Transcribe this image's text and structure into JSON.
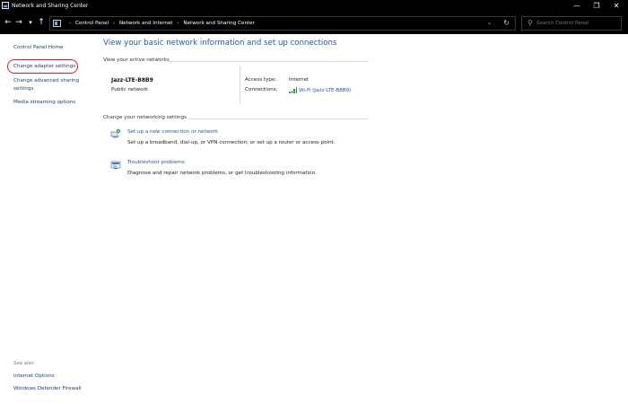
{
  "window": {
    "title": "Network and Sharing Center",
    "minimize_glyph": "—",
    "maximize_glyph": "❐",
    "close_glyph": "✕"
  },
  "nav": {
    "back_glyph": "←",
    "forward_glyph": "→",
    "recent_glyph": "▾",
    "up_glyph": "↑"
  },
  "address": {
    "breadcrumbs": [
      "Control Panel",
      "Network and Internet",
      "Network and Sharing Center"
    ],
    "separator": "›",
    "dropdown_glyph": "⌄",
    "refresh_glyph": "↻"
  },
  "search": {
    "placeholder": "Search Control Panel",
    "icon": "search-icon",
    "glyph": "⚲"
  },
  "sidebar": {
    "links": [
      "Control Panel Home",
      "Change adapter settings",
      "Change advanced sharing",
      "settings",
      "Media streaming options"
    ],
    "see_also_title": "See also",
    "see_also_links": [
      "Internet Options",
      "Windows Defender Firewall"
    ],
    "highlight_color": "#d51f24"
  },
  "main": {
    "heading": "View your basic network information and set up connections",
    "active_networks_title": "View your active networks",
    "network": {
      "name": "Jazz-LTE-B8B9",
      "type": "Public network",
      "access_type_label": "Access type:",
      "access_type_value": "Internet",
      "connections_label": "Connections:",
      "connection_name": "Wi-Fi (Jazz-LTE-B8B9)"
    },
    "change_settings_title": "Change your networking settings",
    "tasks": [
      {
        "link": "Set up a new connection or network",
        "description": "Set up a broadband, dial-up, or VPN connection; or set up a router or access point.",
        "icon": "new-connection-icon"
      },
      {
        "link": "Troubleshoot problems",
        "description": "Diagnose and repair network problems, or get troubleshooting information.",
        "icon": "troubleshoot-icon"
      }
    ]
  },
  "colors": {
    "link": "#1e5aa8",
    "heading": "#1e5aa8",
    "titlebar": "#000000",
    "signal": "#2a9d3a"
  }
}
